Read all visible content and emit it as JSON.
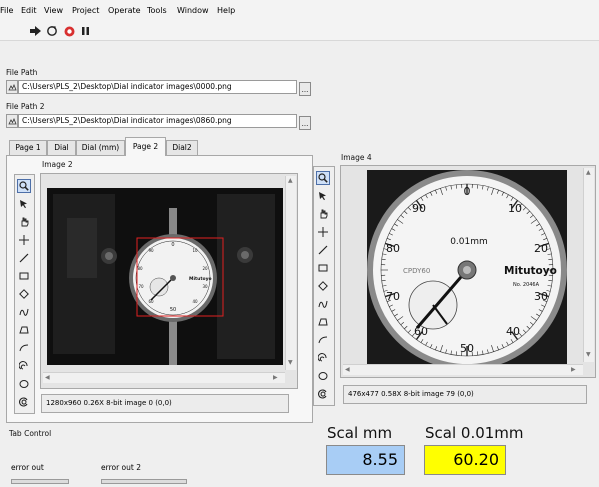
{
  "menu": [
    "File",
    "Edit",
    "View",
    "Project",
    "Operate",
    "Tools",
    "Window",
    "Help"
  ],
  "toolbar": {
    "run_icon": "run-arrow-icon",
    "run_continuous_icon": "run-continuous-icon",
    "abort_icon": "abort-icon",
    "pause_icon": "pause-icon"
  },
  "file_path": {
    "label": "File Path",
    "value": "C:\\Users\\PLS_2\\Desktop\\Dial indicator images\\0000.png",
    "browse": "..."
  },
  "file_path2": {
    "label": "File Path 2",
    "value": "C:\\Users\\PLS_2\\Desktop\\Dial indicator images\\0860.png",
    "browse": "..."
  },
  "tabs": [
    "Page 1",
    "Dial",
    "Dial (mm)",
    "Page 2",
    "Dial2"
  ],
  "active_tab": "Page 2",
  "tab_control_label": "Tab Control",
  "image2": {
    "label": "Image 2",
    "status": "1280x960 0.26X 8-bit image 0    (0,0)"
  },
  "image4": {
    "label": "Image 4",
    "status": "476x477 0.58X 8-bit image 79    (0,0)"
  },
  "palette_tools": [
    "zoom-icon",
    "pointer-icon",
    "pan-hand-icon",
    "crosshair-icon",
    "line-icon",
    "rectangle-icon",
    "rotated-rect-icon",
    "freehand-icon",
    "polygon-icon",
    "polyline-icon",
    "annulus-icon",
    "oval-icon",
    "broken-arc-icon"
  ],
  "gauge": {
    "brand": "Mitutoyo",
    "resolution": "0.01mm",
    "model": "No. 2046A",
    "serial": "CPDY60",
    "outer_ticks": [
      "0",
      "10",
      "20",
      "30",
      "40",
      "50",
      "60",
      "70",
      "80",
      "90"
    ]
  },
  "scal_mm": {
    "label": "Scal mm",
    "value": "8.55",
    "color": "#a8cdf5"
  },
  "scal_001mm": {
    "label": "Scal 0.01mm",
    "value": "60.20",
    "color": "#ffff00"
  },
  "error_out": {
    "label": "error out"
  },
  "error_out2": {
    "label": "error out 2"
  }
}
